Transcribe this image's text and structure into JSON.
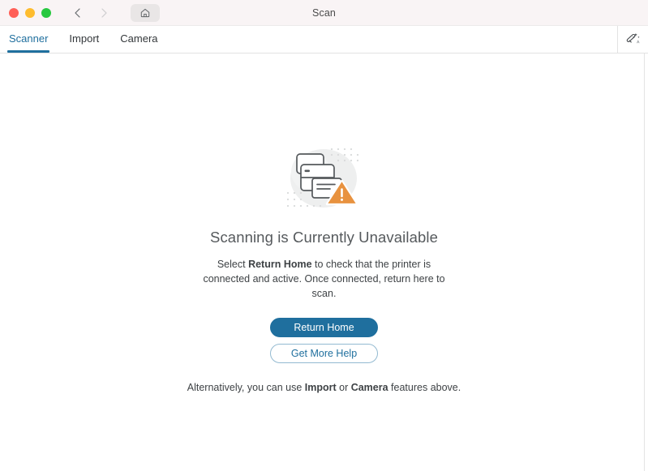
{
  "window": {
    "title": "Scan",
    "traffic_lights": [
      {
        "name": "close",
        "color": "#ff5f57"
      },
      {
        "name": "minimize",
        "color": "#febc2e"
      },
      {
        "name": "maximize",
        "color": "#28c840"
      }
    ],
    "nav": {
      "back_icon": "chevron-left-icon",
      "forward_icon": "chevron-right-icon",
      "home_icon": "home-icon"
    }
  },
  "tabs": [
    {
      "label": "Scanner",
      "active": true
    },
    {
      "label": "Import",
      "active": false
    },
    {
      "label": "Camera",
      "active": false
    }
  ],
  "toolbar": {
    "magic_wand_icon": "magic-wand-icon"
  },
  "main": {
    "illustration": "printer-warning-illustration",
    "headline": "Scanning is Currently Unavailable",
    "subtext": {
      "part1": "Select ",
      "bold1": "Return Home",
      "part2": " to check that the printer is connected and active. Once connected, return here to scan."
    },
    "primary_button": "Return Home",
    "secondary_button": "Get More Help",
    "footnote": {
      "part1": "Alternatively, you can use ",
      "bold1": "Import",
      "part2": " or ",
      "bold2": "Camera",
      "part3": " features above."
    }
  },
  "colors": {
    "accent": "#1f6f9e",
    "accent_border": "#93bad1",
    "warning": "#e8923f",
    "titlebar_bg": "#f9f4f5",
    "headline_text": "#55595c",
    "body_text": "#3e4245"
  }
}
